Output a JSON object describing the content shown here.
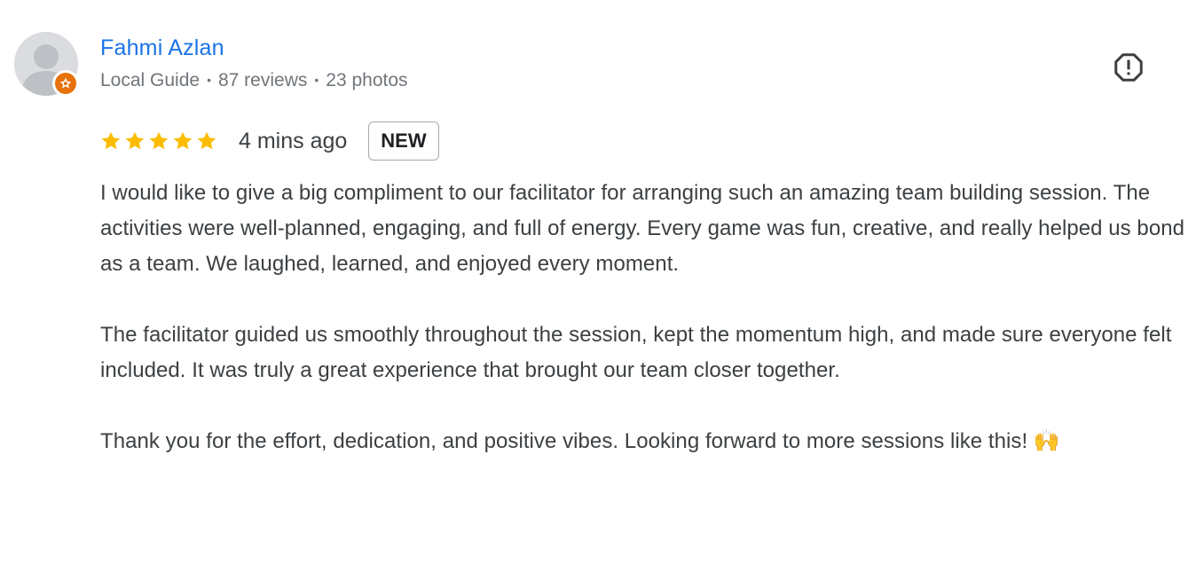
{
  "author": {
    "name": "Fahmi Azlan",
    "level": "Local Guide",
    "reviews": "87 reviews",
    "photos": "23 photos",
    "separator": "•"
  },
  "rating": {
    "stars": 5,
    "max_stars": 5,
    "time": "4 mins ago",
    "badge": "NEW"
  },
  "review": {
    "paragraphs": [
      "I would like to give a big compliment to our facilitator for arranging such an amazing team building session. The activities were well-planned, engaging, and full of energy. Every game was fun, creative, and really helped us bond as a team. We laughed, learned, and enjoyed every moment.",
      "The facilitator guided us smoothly throughout the session, kept the momentum high, and made sure everyone felt included. It was truly a great experience that brought our team closer together.",
      "Thank you for the effort, dedication, and positive vibes. Looking forward to more sessions like this! 🙌"
    ]
  },
  "icons": {
    "avatar": "default-avatar-icon",
    "guide_badge": "local-guide-star-icon",
    "report": "report-octagon-icon",
    "star": "star-icon"
  },
  "colors": {
    "name": "#1a73e8",
    "meta": "#70757a",
    "text": "#3c4043",
    "star": "#fbbc04",
    "guide_badge": "#e8710a"
  }
}
